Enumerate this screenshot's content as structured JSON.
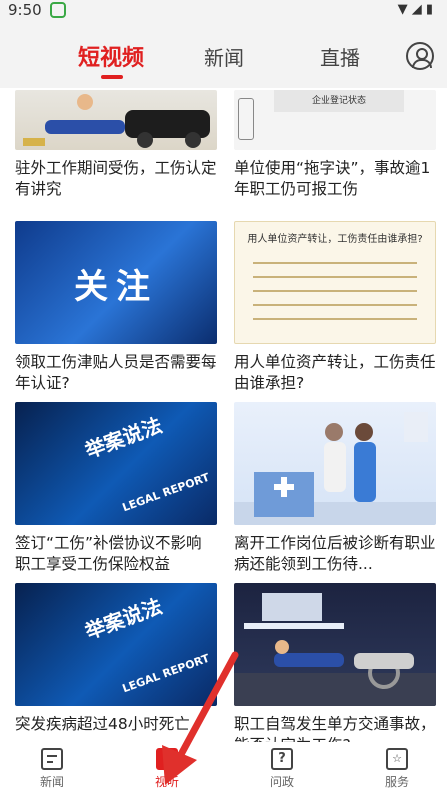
{
  "status": {
    "time": "9:50",
    "app_icon": "d-app-icon",
    "right_icons": "wifi signal battery"
  },
  "tabs": [
    {
      "label": "短视频",
      "active": true
    },
    {
      "label": "新闻",
      "active": false
    },
    {
      "label": "直播",
      "active": false
    }
  ],
  "cards": [
    {
      "title": "驻外工作期间受伤，工伤认定有讲究"
    },
    {
      "title": "单位使用“拖字诀”，事故逾1年职工仍可报工伤",
      "thumb_text": "企业登记状态"
    },
    {
      "title": "领取工伤津贴人员是否需要每年认证?",
      "thumb_text": "关注"
    },
    {
      "title": "用人单位资产转让，工伤责任由谁承担?",
      "thumb_text": "用人单位资产转让，工伤责任由谁承担?"
    },
    {
      "title": "签订“工伤”补偿协议不影响职工享受工伤保险权益",
      "thumb_text": "举案说法",
      "thumb_sub": "LEGAL REPORT"
    },
    {
      "title": "离开工作岗位后被诊断有职业病还能领到工伤待..."
    },
    {
      "title": "突发疾病超过48小时死亡",
      "thumb_text": "举案说法",
      "thumb_sub": "LEGAL REPORT"
    },
    {
      "title": "职工自驾发生单方交通事故，能否认定为工伤?"
    }
  ],
  "bottom_nav": [
    {
      "label": "新闻",
      "icon": "news-icon",
      "active": false
    },
    {
      "label": "视听",
      "icon": "video-icon",
      "active": true
    },
    {
      "label": "问政",
      "icon": "question-icon",
      "active": false
    },
    {
      "label": "服务",
      "icon": "service-icon",
      "active": false
    }
  ],
  "colors": {
    "accent": "#e02020",
    "arrow": "#e0302c"
  }
}
